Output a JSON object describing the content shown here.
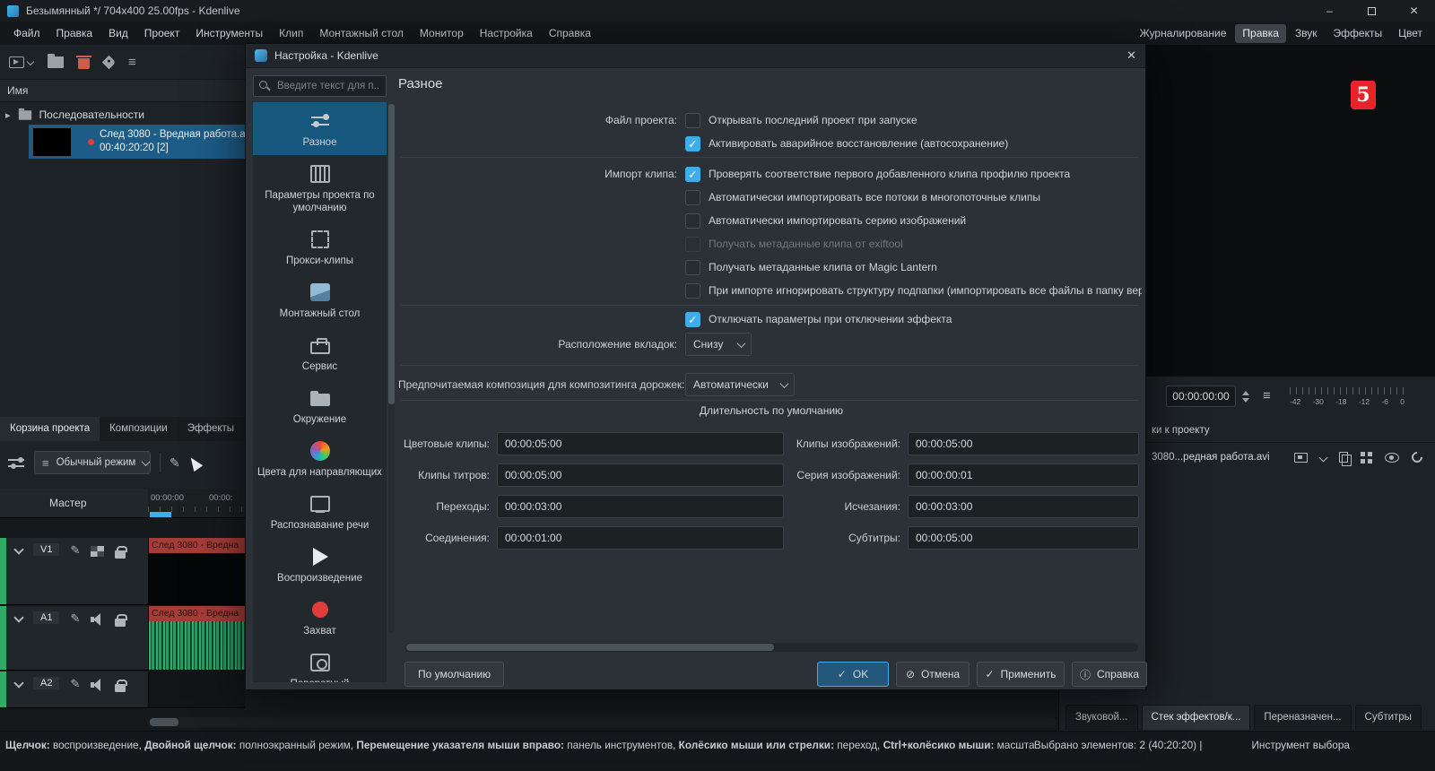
{
  "titlebar": {
    "title": "Безымянный */ 704x400 25.00fps - Kdenlive"
  },
  "menubar": {
    "items": [
      "Файл",
      "Правка",
      "Вид",
      "Проект",
      "Инструменты",
      "Клип",
      "Монтажный стол",
      "Монитор",
      "Настройка",
      "Справка"
    ],
    "layouts": [
      {
        "label": "Журналирование",
        "active": false
      },
      {
        "label": "Правка",
        "active": true
      },
      {
        "label": "Звук",
        "active": false
      },
      {
        "label": "Эффекты",
        "active": false
      },
      {
        "label": "Цвет",
        "active": false
      }
    ]
  },
  "bin": {
    "name_header": "Имя",
    "folder_label": "Последовательности",
    "clip": {
      "title": "След 3080 - Вредная работа.а",
      "meta": "00:40:20:20 [2]"
    },
    "tabs": [
      {
        "label": "Корзина проекта",
        "active": true
      },
      {
        "label": "Композиции",
        "active": false
      },
      {
        "label": "Эффекты",
        "active": false
      }
    ]
  },
  "timeline_bar": {
    "mode": "Обычный режим"
  },
  "timeline": {
    "master": "Мастер",
    "ruler": [
      "00:00:00",
      "00:00:"
    ],
    "tracks": [
      {
        "id": "V1",
        "clip": "След 3080 - Вредна"
      },
      {
        "id": "A1",
        "clip": "След 3080 - Вредна"
      },
      {
        "id": "A2",
        "clip": ""
      }
    ]
  },
  "monitor": {
    "logo": "5",
    "timecode": "00:00:00:00",
    "meter_labels": [
      "-42",
      "-30",
      "-18",
      "-12",
      "-6",
      "0"
    ]
  },
  "right_panel": {
    "tab_partial": "ки к проекту",
    "clip_name": "3080...редная работа.avi",
    "tabs": [
      {
        "label": "Звуковой...",
        "active": false
      },
      {
        "label": "Стек эффектов/к...",
        "active": true
      },
      {
        "label": "Переназначен...",
        "active": false
      },
      {
        "label": "Субтитры",
        "active": false
      }
    ]
  },
  "statusbar": {
    "hints": [
      {
        "b": "Щелчок:",
        "t": " воспроизведение, "
      },
      {
        "b": "Двойной щелчок:",
        "t": " полноэкранный режим, "
      },
      {
        "b": "Перемещение указателя мыши вправо:",
        "t": " панель инструментов, "
      },
      {
        "b": "Колёсико мыши или стрелки:",
        "t": " переход, "
      },
      {
        "b": "Ctrl+колёсико мыши:",
        "t": " масштаб"
      }
    ],
    "selection": "Выбрано элементов: 2 (40:20:20) |",
    "tool": "Инструмент выбора"
  },
  "dialog": {
    "title": "Настройка - Kdenlive",
    "search_placeholder": "Введите текст для п...",
    "page_title": "Разное",
    "sidebar": [
      {
        "label": "Разное",
        "icon": "misc",
        "selected": true
      },
      {
        "label": "Параметры проекта по умолчанию",
        "icon": "project",
        "selected": false
      },
      {
        "label": "Прокси-клипы",
        "icon": "proxy",
        "selected": false
      },
      {
        "label": "Монтажный стол",
        "icon": "timeline",
        "selected": false
      },
      {
        "label": "Сервис",
        "icon": "service",
        "selected": false
      },
      {
        "label": "Окружение",
        "icon": "env",
        "selected": false
      },
      {
        "label": "Цвета для направляющих",
        "icon": "colors",
        "selected": false
      },
      {
        "label": "Распознавание речи",
        "icon": "speech",
        "selected": false
      },
      {
        "label": "Воспроизведение",
        "icon": "play",
        "selected": false
      },
      {
        "label": "Захват",
        "icon": "capture",
        "selected": false
      },
      {
        "label": "Поворотный",
        "icon": "rotate",
        "selected": false
      }
    ],
    "project_file": {
      "label": "Файл проекта:",
      "options": [
        {
          "label": "Открывать последний проект при запуске",
          "checked": false
        },
        {
          "label": "Активировать аварийное восстановление (автосохранение)",
          "checked": true
        }
      ]
    },
    "clip_import": {
      "label": "Импорт клипа:",
      "options": [
        {
          "label": "Проверять соответствие первого добавленного клипа профилю проекта",
          "checked": true
        },
        {
          "label": "Автоматически импортировать все потоки в многопоточные клипы",
          "checked": false
        },
        {
          "label": "Автоматически импортировать серию изображений",
          "checked": false
        },
        {
          "label": "Получать метаданные клипа от exiftool",
          "checked": false,
          "disabled": true
        },
        {
          "label": "Получать метаданные клипа от Magic Lantern",
          "checked": false
        },
        {
          "label": "При импорте игнорировать структуру подпапки (импортировать все файлы в папку верх",
          "checked": false
        }
      ]
    },
    "disable_effect": {
      "options": [
        {
          "label": "Отключать параметры при отключении эффекта",
          "checked": true
        }
      ]
    },
    "tab_position": {
      "label": "Расположение вкладок:",
      "value": "Снизу"
    },
    "composition": {
      "label": "Предпочитаемая композиция для композитинга дорожек:",
      "value": "Автоматически"
    },
    "durations": {
      "title": "Длительность по умолчанию",
      "fields": [
        {
          "label": "Цветовые клипы:",
          "value": "00:00:05:00"
        },
        {
          "label": "Клипы изображений:",
          "value": "00:00:05:00"
        },
        {
          "label": "Клипы титров:",
          "value": "00:00:05:00"
        },
        {
          "label": "Серия изображений:",
          "value": "00:00:00:01"
        },
        {
          "label": "Переходы:",
          "value": "00:00:03:00"
        },
        {
          "label": "Исчезания:",
          "value": "00:00:03:00"
        },
        {
          "label": "Соединения:",
          "value": "00:00:01:00"
        },
        {
          "label": "Субтитры:",
          "value": "00:00:05:00"
        }
      ]
    },
    "buttons": {
      "defaults": "По умолчанию",
      "ok": "OK",
      "cancel": "Отмена",
      "apply": "Применить",
      "help": "Справка"
    }
  }
}
